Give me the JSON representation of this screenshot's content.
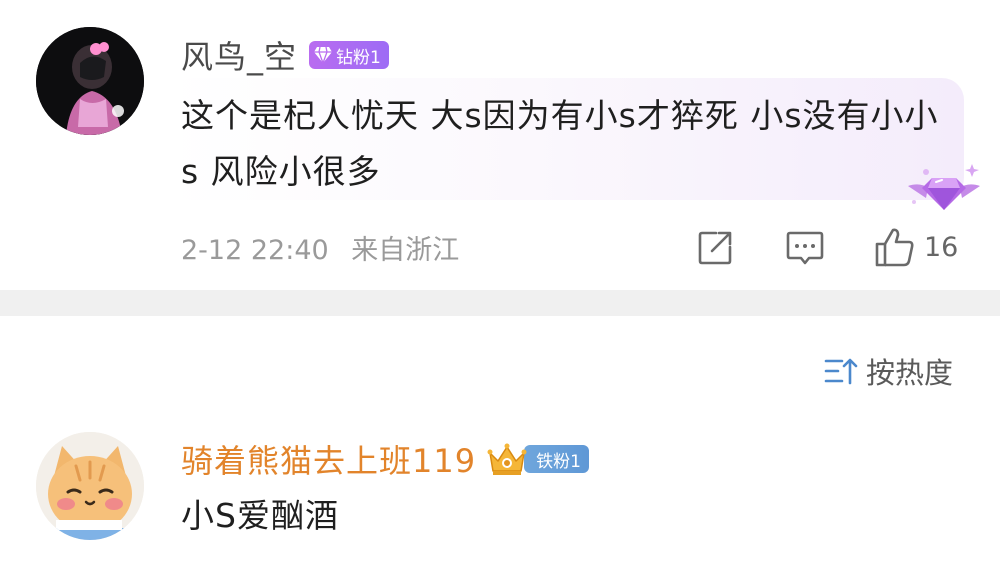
{
  "comments": [
    {
      "username": "风鸟_空",
      "badge": "钻粉1",
      "text": "这个是杞人忧天  大s因为有小s才猝死 小s没有小小s 风险小很多",
      "date": "2-12 22:40",
      "location": "来自浙江",
      "like_count": "16"
    },
    {
      "username": "骑着熊猫去上班119",
      "badge": "铁粉1",
      "text": "小S爱酗酒"
    }
  ],
  "sort": {
    "label": "按热度"
  },
  "icons": {
    "share": "share-icon",
    "reply": "comment-icon",
    "like": "thumbs-up-icon",
    "sort": "sort-icon",
    "diamond": "diamond-icon",
    "crown": "crown-icon"
  },
  "colors": {
    "username_primary": "#4a4a4a",
    "username_highlight": "#e2842b",
    "diamond_badge": "#b96cf0",
    "iron_badge": "#6fa6dc",
    "meta_text": "#9a9a9a",
    "divider": "#f0f0f0"
  }
}
